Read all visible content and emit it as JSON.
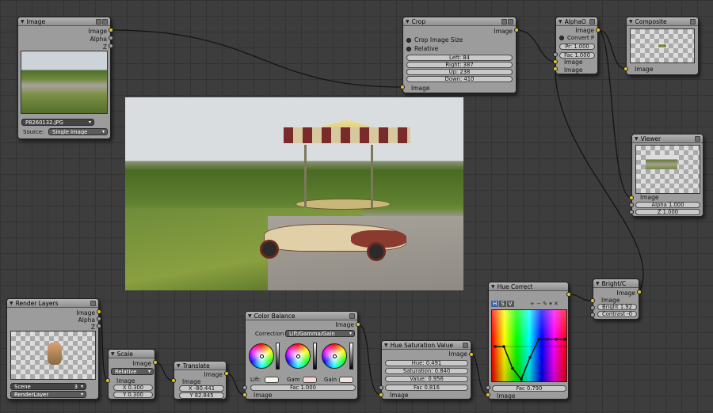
{
  "colors": {
    "socket_color": "#e0c42a",
    "socket_value": "#9e9e9e",
    "socket_vector": "#7a8ee0",
    "node_bg": "#9c9c9c",
    "grid_bg": "#3d3d3d"
  },
  "image_node": {
    "title": "Image",
    "outputs": [
      "Image",
      "Alpha",
      "Z"
    ],
    "filename": "P8260132.JPG",
    "source_label": "Source:",
    "source_value": "Single Image"
  },
  "crop_node": {
    "title": "Crop",
    "output": "Image",
    "options": [
      "Crop Image Size",
      "Relative"
    ],
    "fields": [
      "Left: 84",
      "Right: 387",
      "Up: 238",
      "Down: 410"
    ],
    "input": "Image"
  },
  "alphaover_node": {
    "title": "AlphaO",
    "output": "Image",
    "option": "Convert P",
    "pr": "Pr: 1.000",
    "fac": "Fac 1.000",
    "inputs": [
      "Image",
      "Image"
    ]
  },
  "composite_node": {
    "title": "Composite",
    "input": "Image"
  },
  "viewer_node": {
    "title": "Viewer",
    "input": "Image",
    "alpha": "Alpha 1.000",
    "z": "Z 1.000"
  },
  "render_layers_node": {
    "title": "Render Layers",
    "outputs": [
      "Image",
      "Alpha",
      "Z"
    ],
    "scene": "Scene",
    "scene_num": "3",
    "layer": "RenderLayer"
  },
  "scale_node": {
    "title": "Scale",
    "output": "Image",
    "mode": "Relative",
    "input": "Image",
    "x": "X 0.300",
    "y": "Y 0.300"
  },
  "translate_node": {
    "title": "Translate",
    "output": "Image",
    "input": "Image",
    "x": "X -80.441",
    "y": "Y 82.845"
  },
  "color_balance_node": {
    "title": "Color Balance",
    "output": "Image",
    "correction_label": "Correction F",
    "correction_value": "Lift/Gamma/Gain",
    "lift": "Lift:",
    "gamma": "Gam",
    "gain": "Gain",
    "fac": "Fac 1.000",
    "input": "Image"
  },
  "hsv_node": {
    "title": "Hue Saturation Value",
    "output": "Image",
    "hue": "Hue: 0.491",
    "saturation": "Saturation: 0.840",
    "value": "Value: 0.956",
    "fac": "Fac 0.816",
    "input": "Image"
  },
  "hue_correct_node": {
    "title": "Hue Correct",
    "tabs": [
      "H",
      "S",
      "V"
    ],
    "fac": "Fac 0.790",
    "input": "Image"
  },
  "bright_contrast_node": {
    "title": "Bright/C",
    "output": "Image",
    "input": "Image",
    "bright": "Bright 1.92",
    "contrast": "Contrast -0"
  },
  "hue_curve": [
    0.5,
    0.5,
    0.2,
    0.05,
    0.35,
    0.6,
    0.6,
    0.6,
    0.6
  ]
}
